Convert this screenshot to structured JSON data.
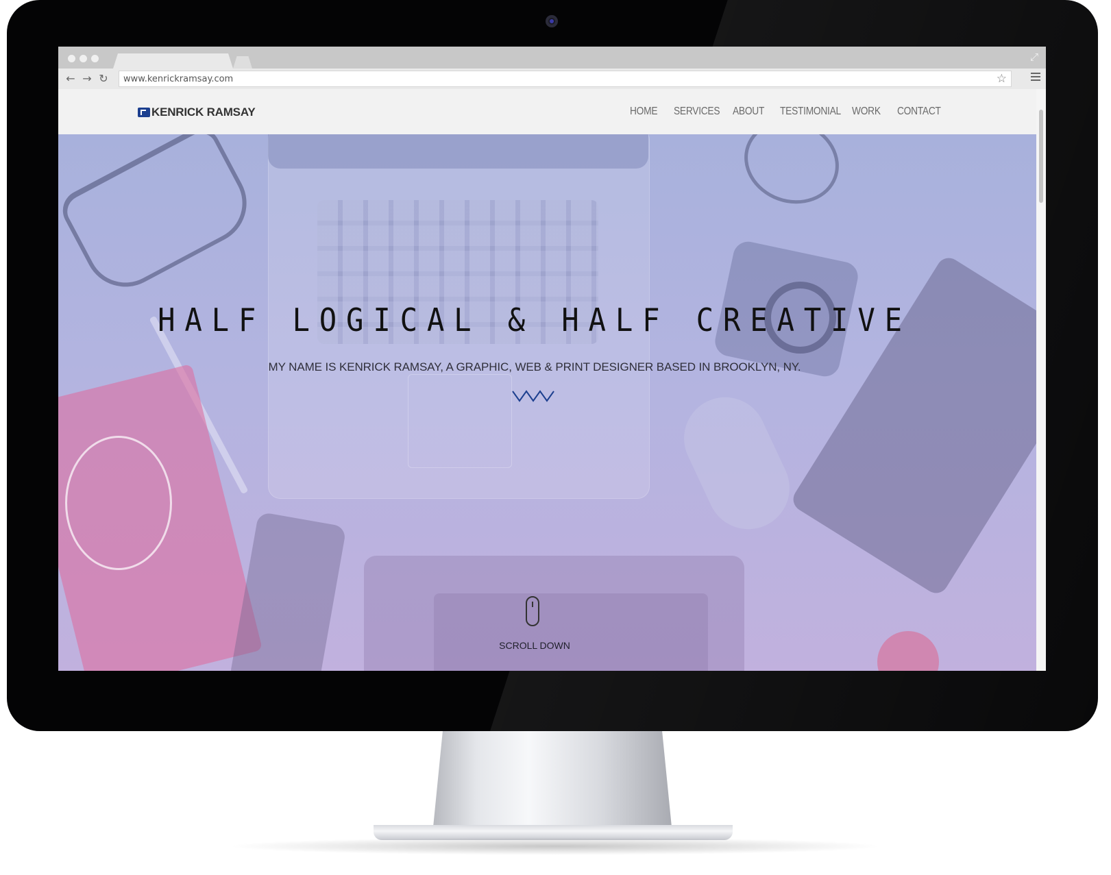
{
  "browser": {
    "url": "www.kenrickramsay.com"
  },
  "site": {
    "logo_text": "KENRICK RAMSAY",
    "nav": [
      "HOME",
      "SERVICES",
      "ABOUT",
      "TESTIMONIAL",
      "WORK",
      "CONTACT"
    ],
    "hero_title": "HALF LOGICAL & HALF CREATIVE",
    "hero_subtitle": "MY NAME IS KENRICK RAMSAY, A GRAPHIC, WEB & PRINT DESIGNER BASED IN BROOKLYN, NY.",
    "scroll_label": "SCROLL DOWN"
  },
  "colors": {
    "logo_mark": "#1c3f8f",
    "accent_zigzag": "#1c3f8f"
  },
  "icons": {
    "back": "arrow-left-icon",
    "forward": "arrow-right-icon",
    "reload": "reload-icon",
    "bookmark": "star-icon",
    "menu": "hamburger-icon",
    "fullscreen": "expand-icon",
    "scroll": "mouse-icon"
  }
}
